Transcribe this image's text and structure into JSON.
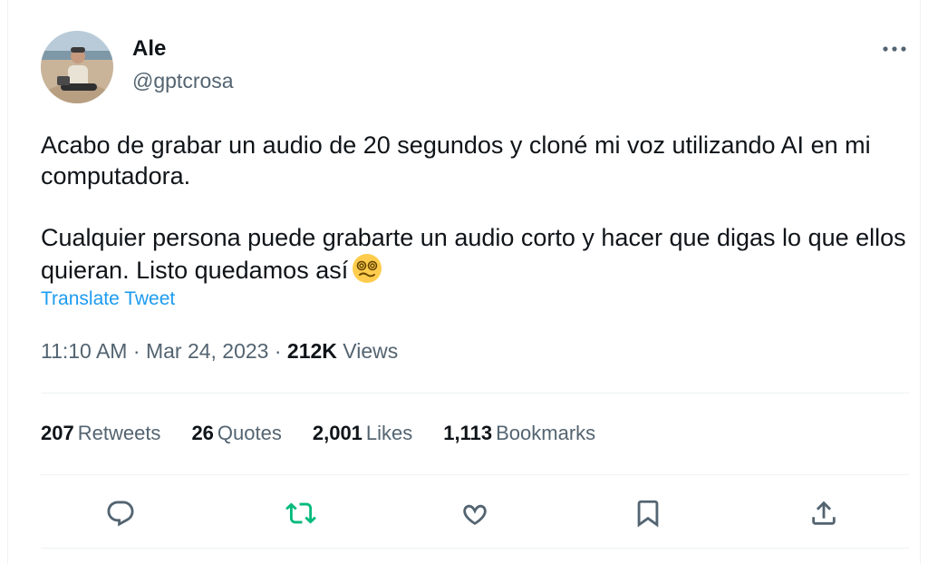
{
  "user": {
    "name": "Ale",
    "handle": "@gptcrosa"
  },
  "tweet": {
    "paragraphs": [
      "Acabo de grabar un audio de 20 segundos y cloné mi voz utilizando AI en mi computadora.",
      "Cualquier persona puede grabarte un audio corto y hacer que digas lo que ellos quieran. Listo quedamos así"
    ],
    "emoji": "face-with-spiral-eyes",
    "translate_label": "Translate Tweet"
  },
  "meta": {
    "time": "11:10 AM",
    "separator": "·",
    "date": "Mar 24, 2023",
    "views_count": "212K",
    "views_label": "Views"
  },
  "stats": [
    {
      "count": "207",
      "label": "Retweets"
    },
    {
      "count": "26",
      "label": "Quotes"
    },
    {
      "count": "2,001",
      "label": "Likes"
    },
    {
      "count": "1,113",
      "label": "Bookmarks"
    }
  ],
  "actions": {
    "icons": [
      "reply-icon",
      "retweet-icon",
      "like-icon",
      "bookmark-icon",
      "share-icon"
    ]
  },
  "colors": {
    "text": "#0f1419",
    "secondary": "#536471",
    "link": "#1d9bf0",
    "retweet": "#00ba7c",
    "divider": "#eff3f4"
  }
}
